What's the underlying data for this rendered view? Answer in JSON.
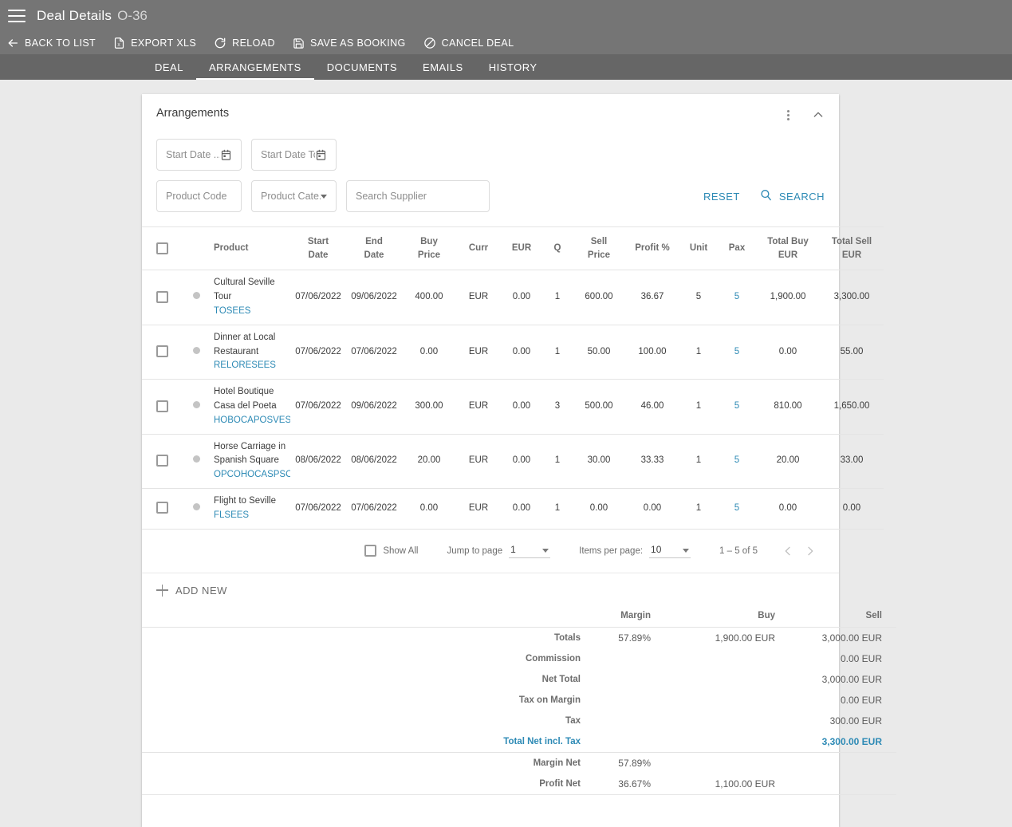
{
  "appbar": {
    "menu_icon": "hamburger-icon",
    "title": "Deal Details",
    "subtitle": "O-36",
    "actions": [
      {
        "label": "BACK TO LIST",
        "icon": "arrow-left-icon"
      },
      {
        "label": "EXPORT XLS",
        "icon": "file-xls-icon"
      },
      {
        "label": "RELOAD",
        "icon": "refresh-icon"
      },
      {
        "label": "SAVE AS BOOKING",
        "icon": "save-disk-icon"
      },
      {
        "label": "CANCEL DEAL",
        "icon": "cancel-circle-icon"
      }
    ]
  },
  "tabs": [
    {
      "label": "DEAL",
      "active": false
    },
    {
      "label": "ARRANGEMENTS",
      "active": true
    },
    {
      "label": "DOCUMENTS",
      "active": false
    },
    {
      "label": "EMAILS",
      "active": false
    },
    {
      "label": "HISTORY",
      "active": false
    }
  ],
  "card": {
    "title": "Arrangements",
    "menu_icon": "more-vert-icon",
    "collapse_icon": "chevron-up-icon"
  },
  "filters": {
    "start_date_from": {
      "placeholder": "Start Date ...",
      "value": "",
      "icon": "calendar-icon"
    },
    "start_date_to": {
      "placeholder": "Start Date To",
      "value": "",
      "icon": "calendar-icon"
    },
    "product_code": {
      "placeholder": "Product Code",
      "value": ""
    },
    "product_category": {
      "placeholder": "Product Cate...",
      "value": "",
      "icon": "chevron-down-icon"
    },
    "supplier": {
      "placeholder": "Search Supplier",
      "value": ""
    },
    "reset_label": "RESET",
    "search_label": "SEARCH",
    "search_icon": "search-icon"
  },
  "table": {
    "columns": [
      "",
      "",
      "Product",
      "Start Date",
      "End Date",
      "Buy Price",
      "Curr",
      "EUR",
      "Q",
      "Sell Price",
      "Profit %",
      "Unit",
      "Pax",
      "Total Buy EUR",
      "Total Sell EUR"
    ],
    "columns_split": {
      "start_date": [
        "Start",
        "Date"
      ],
      "end_date": [
        "End",
        "Date"
      ],
      "buy_price": [
        "Buy",
        "Price"
      ],
      "sell_price": [
        "Sell",
        "Price"
      ],
      "total_buy": [
        "Total Buy",
        "EUR"
      ],
      "total_sell": [
        "Total Sell",
        "EUR"
      ],
      "product": "Product",
      "curr": "Curr",
      "eur": "EUR",
      "q": "Q",
      "profit": "Profit %",
      "unit": "Unit",
      "pax": "Pax"
    },
    "rows": [
      {
        "product_name": "Cultural Seville Tour",
        "product_code": "TOSEES",
        "start_date": "07/06/2022",
        "end_date": "09/06/2022",
        "buy_price": "400.00",
        "curr": "EUR",
        "eur": "0.00",
        "q": "1",
        "sell_price": "600.00",
        "profit": "36.67",
        "unit": "5",
        "pax": "5",
        "total_buy": "1,900.00",
        "total_sell": "3,300.00"
      },
      {
        "product_name": "Dinner at Local Restaurant",
        "product_code": "RELORESEES",
        "start_date": "07/06/2022",
        "end_date": "07/06/2022",
        "buy_price": "0.00",
        "curr": "EUR",
        "eur": "0.00",
        "q": "1",
        "sell_price": "50.00",
        "profit": "100.00",
        "unit": "1",
        "pax": "5",
        "total_buy": "0.00",
        "total_sell": "55.00"
      },
      {
        "product_name": "Hotel Boutique Casa del Poeta",
        "product_code": "HOBOCAPOSVES",
        "start_date": "07/06/2022",
        "end_date": "09/06/2022",
        "buy_price": "300.00",
        "curr": "EUR",
        "eur": "0.00",
        "q": "3",
        "sell_price": "500.00",
        "profit": "46.00",
        "unit": "1",
        "pax": "5",
        "total_buy": "810.00",
        "total_sell": "1,650.00"
      },
      {
        "product_name": "Horse Carriage in Spanish Square",
        "product_code": "OPCOHOCASPSO",
        "start_date": "08/06/2022",
        "end_date": "08/06/2022",
        "buy_price": "20.00",
        "curr": "EUR",
        "eur": "0.00",
        "q": "1",
        "sell_price": "30.00",
        "profit": "33.33",
        "unit": "1",
        "pax": "5",
        "total_buy": "20.00",
        "total_sell": "33.00"
      },
      {
        "product_name": "Flight to Seville",
        "product_code": "FLSEES",
        "start_date": "07/06/2022",
        "end_date": "07/06/2022",
        "buy_price": "0.00",
        "curr": "EUR",
        "eur": "0.00",
        "q": "1",
        "sell_price": "0.00",
        "profit": "0.00",
        "unit": "1",
        "pax": "5",
        "total_buy": "0.00",
        "total_sell": "0.00"
      }
    ]
  },
  "paginator": {
    "show_all_label": "Show All",
    "jump_label": "Jump to page",
    "jump_value": "1",
    "items_per_page_label": "Items per page:",
    "items_per_page_value": "10",
    "range_label": "1 – 5 of 5",
    "prev_icon": "chevron-left-icon",
    "next_icon": "chevron-right-icon"
  },
  "add_new": {
    "label": "ADD NEW",
    "icon": "plus-icon"
  },
  "summary": {
    "headers": {
      "margin": "Margin",
      "buy": "Buy",
      "sell": "Sell"
    },
    "rows": [
      {
        "label": "Totals",
        "margin": "57.89%",
        "buy": "1,900.00 EUR",
        "sell": "3,000.00 EUR",
        "accent": false
      },
      {
        "label": "Commission",
        "margin": "",
        "buy": "",
        "sell": "0.00 EUR",
        "accent": false
      },
      {
        "label": "Net Total",
        "margin": "",
        "buy": "",
        "sell": "3,000.00 EUR",
        "accent": false
      },
      {
        "label": "Tax on Margin",
        "margin": "",
        "buy": "",
        "sell": "0.00 EUR",
        "accent": false
      },
      {
        "label": "Tax",
        "margin": "",
        "buy": "",
        "sell": "300.00 EUR",
        "accent": false
      },
      {
        "label": "Total Net incl. Tax",
        "margin": "",
        "buy": "",
        "sell": "3,300.00 EUR",
        "accent": true
      }
    ],
    "net_rows": [
      {
        "label": "Margin Net",
        "margin": "57.89%",
        "buy": ""
      },
      {
        "label": "Profit Net",
        "margin": "36.67%",
        "buy": "1,100.00 EUR"
      }
    ]
  },
  "colors": {
    "appbar": "#757575",
    "tabbar": "#666666",
    "page_bg": "#eaeaea",
    "accent": "#2d8ab5",
    "text": "#3c3c3c",
    "muted": "#6d6d6d"
  }
}
